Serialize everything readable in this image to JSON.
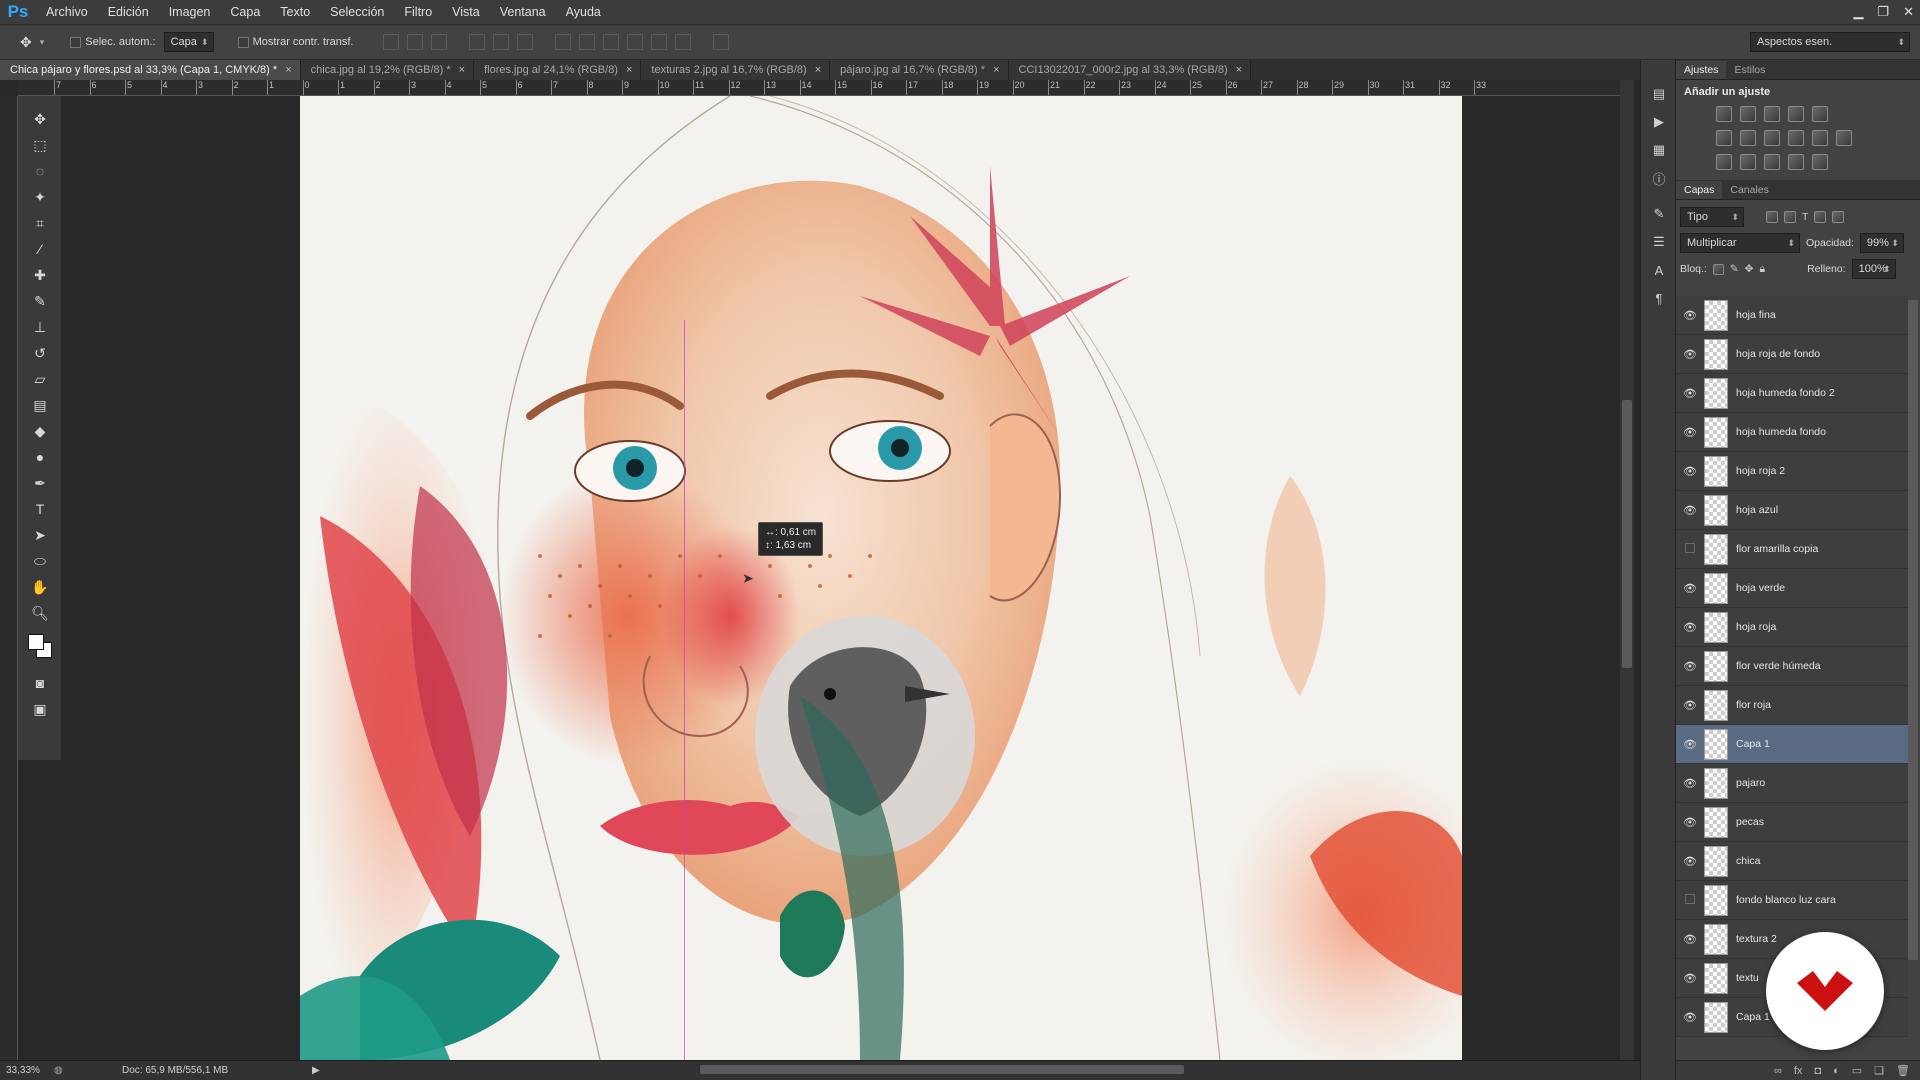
{
  "app": {
    "logo": "Ps",
    "menu": [
      "Archivo",
      "Edición",
      "Imagen",
      "Capa",
      "Texto",
      "Selección",
      "Filtro",
      "Vista",
      "Ventana",
      "Ayuda"
    ]
  },
  "options": {
    "auto_select_label": "Selec. autom.:",
    "auto_select_value": "Capa",
    "show_transform_label": "Mostrar contr. transf.",
    "workspace": "Aspectos esen."
  },
  "tabs": [
    {
      "label": "Chica pájaro y flores.psd al 33,3% (Capa 1, CMYK/8) *",
      "active": true
    },
    {
      "label": "chica.jpg al 19,2% (RGB/8) *",
      "active": false
    },
    {
      "label": "flores.jpg al 24,1% (RGB/8)",
      "active": false
    },
    {
      "label": "texturas 2.jpg al 16,7% (RGB/8)",
      "active": false
    },
    {
      "label": "pájaro.jpg al 16,7% (RGB/8) *",
      "active": false
    },
    {
      "label": "CCI13022017_000r2.jpg al 33,3% (RGB/8)",
      "active": false
    }
  ],
  "ruler": {
    "labels": [
      "7",
      "6",
      "5",
      "4",
      "3",
      "2",
      "1",
      "0",
      "1",
      "2",
      "3",
      "4",
      "5",
      "6",
      "7",
      "8",
      "9",
      "10",
      "11",
      "12",
      "13",
      "14",
      "15",
      "16",
      "17",
      "18",
      "19",
      "20",
      "21",
      "22",
      "23",
      "24",
      "25",
      "26",
      "27",
      "28",
      "29",
      "30",
      "31",
      "32",
      "33"
    ]
  },
  "measure": {
    "line1": "↔: 0,61 cm",
    "line2": "↕: 1,63 cm"
  },
  "status": {
    "zoom": "33,33%",
    "doc": "Doc: 65,9 MB/556,1 MB"
  },
  "panels": {
    "adjust_tab": "Ajustes",
    "styles_tab": "Estilos",
    "adjust_title": "Añadir un ajuste",
    "layers_tab": "Capas",
    "channels_tab": "Canales",
    "filter_kind": "Tipo",
    "blend_mode": "Multiplicar",
    "opacity_label": "Opacidad:",
    "opacity_value": "99%",
    "lock_label": "Bloq.:",
    "fill_label": "Relleno:",
    "fill_value": "100%"
  },
  "layers": [
    {
      "name": "hoja fina",
      "visible": true,
      "selected": false
    },
    {
      "name": "hoja roja de fondo",
      "visible": true,
      "selected": false
    },
    {
      "name": "hoja humeda fondo 2",
      "visible": true,
      "selected": false
    },
    {
      "name": "hoja humeda fondo",
      "visible": true,
      "selected": false
    },
    {
      "name": "hoja roja 2",
      "visible": true,
      "selected": false
    },
    {
      "name": "hoja azul",
      "visible": true,
      "selected": false
    },
    {
      "name": "flor amarilla copia",
      "visible": false,
      "selected": false
    },
    {
      "name": "hoja verde",
      "visible": true,
      "selected": false
    },
    {
      "name": "hoja roja",
      "visible": true,
      "selected": false
    },
    {
      "name": "flor verde húmeda",
      "visible": true,
      "selected": false
    },
    {
      "name": "flor roja",
      "visible": true,
      "selected": false
    },
    {
      "name": "Capa 1",
      "visible": true,
      "selected": true
    },
    {
      "name": "pajaro",
      "visible": true,
      "selected": false
    },
    {
      "name": "pecas",
      "visible": true,
      "selected": false
    },
    {
      "name": "chica",
      "visible": true,
      "selected": false
    },
    {
      "name": "fondo blanco luz cara",
      "visible": false,
      "selected": false
    },
    {
      "name": "textura 2",
      "visible": true,
      "selected": false
    },
    {
      "name": "textu",
      "visible": true,
      "selected": false
    },
    {
      "name": "Capa 1",
      "visible": true,
      "selected": false
    }
  ],
  "colors": {
    "accent": "#31a8ff",
    "selected_layer": "#5a6a82",
    "guide": "#c040c0",
    "brand": "#cc1010"
  }
}
